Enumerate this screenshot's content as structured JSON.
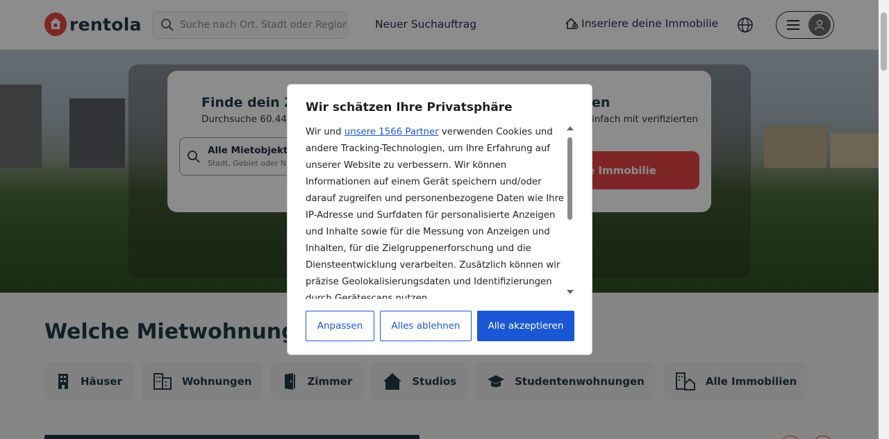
{
  "header": {
    "logo_text": "rentola",
    "search_placeholder": "Suche nach Ort, Stadt oder Region",
    "nav_suchauftrag": "Neuer Suchauftrag",
    "nav_inserieren": "Inseriere deine Immobilie"
  },
  "hero": {
    "card_title": "Finde dein Zu",
    "card_subtitle": "Durchsuche 60.449",
    "search_title": "Alle Mietobjekte",
    "search_subtitle": "Stadt, Gebiet oder N",
    "right_title": "en",
    "right_subtitle": "infach mit verifizierten",
    "right_button": "e Immobilie"
  },
  "main": {
    "section_title": "Welche Mietwohnung be",
    "categories": [
      {
        "label": "Häuser",
        "icon": "building-icon"
      },
      {
        "label": "Wohnungen",
        "icon": "apartment-icon"
      },
      {
        "label": "Zimmer",
        "icon": "door-icon"
      },
      {
        "label": "Studios",
        "icon": "house-icon"
      },
      {
        "label": "Studentenwohnungen",
        "icon": "graduation-cap-icon"
      },
      {
        "label": "Alle Immobilien",
        "icon": "buildings-home-icon"
      }
    ]
  },
  "modal": {
    "title": "Wir schätzen Ihre Privatsphäre",
    "text_before_link": "Wir und ",
    "link_text": "unsere 1566 Partner",
    "text_after_link": " verwenden Cookies und andere Tracking-Technologien, um Ihre Erfahrung auf unserer Website zu verbessern. Wir können Informationen auf einem Gerät speichern und/oder darauf zugreifen und personenbezogene Daten wie Ihre IP-Adresse und Surfdaten für personalisierte Anzeigen und Inhalte sowie für die Messung von Anzeigen und Inhalten, für die Zielgruppenerforschung und die Diensteentwicklung verarbeiten. Zusätzlich können wir präzise Geolokalisierungsdaten und Identifizierungen durch Gerätescans nutzen.",
    "btn_customize": "Anpassen",
    "btn_reject": "Alles ablehnen",
    "btn_accept": "Alle akzeptieren"
  },
  "colors": {
    "brand_red": "#e64545",
    "primary_blue": "#1a57d6",
    "dark_text": "#1f3b45"
  }
}
